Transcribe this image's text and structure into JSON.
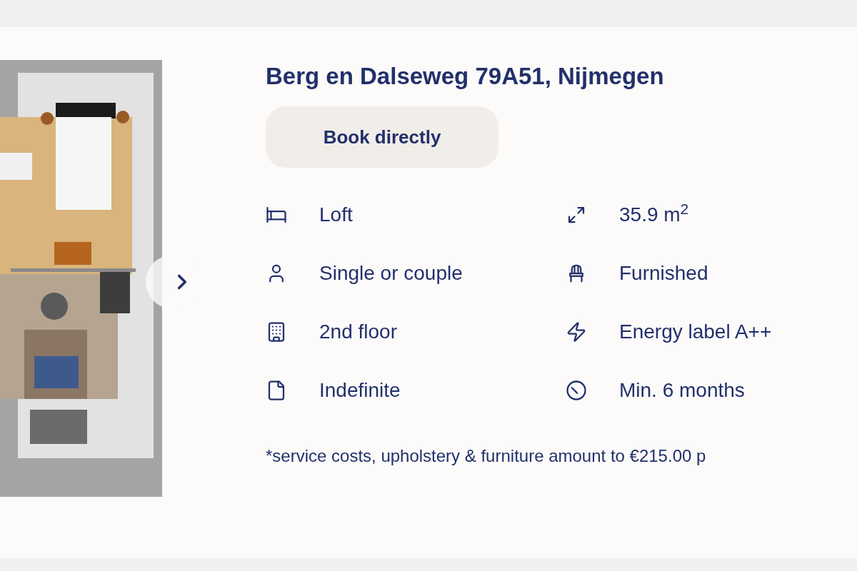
{
  "listing": {
    "address": "Berg en Dalseweg 79A51, Nijmegen",
    "book_button": "Book directly",
    "features": [
      {
        "kind": "bed",
        "text": "Loft"
      },
      {
        "kind": "area",
        "text": "35.9 m$^{2}$"
      },
      {
        "kind": "person",
        "text": "Single or couple"
      },
      {
        "kind": "chair",
        "text": "Furnished"
      },
      {
        "kind": "building",
        "text": "2nd floor"
      },
      {
        "kind": "energy",
        "text": "Energy label A++"
      },
      {
        "kind": "document",
        "text": "Indefinite"
      },
      {
        "kind": "duration",
        "text": "Min. 6 months"
      }
    ],
    "footnote": "*service costs, upholstery & furniture amount to €215.00 p"
  }
}
